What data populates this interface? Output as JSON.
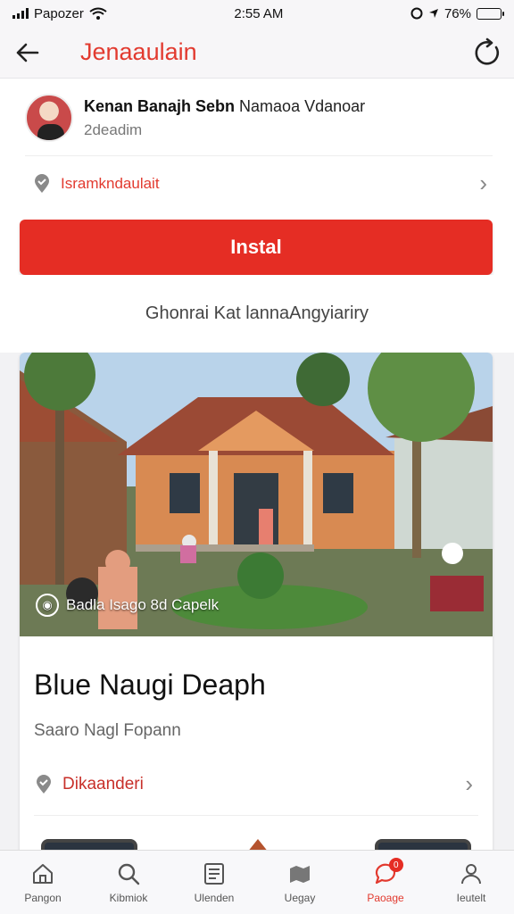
{
  "status_bar": {
    "carrier": "Papozer",
    "time": "2:55 AM",
    "battery": "76%",
    "battery_level": 0.68
  },
  "header": {
    "title": "Jenaaulain",
    "back_icon": "back-arrow-icon",
    "refresh_icon": "refresh-icon"
  },
  "profile": {
    "name": "Kenan Banajh Sebn",
    "name_suffix": "Namaoa Vdanoar",
    "subtitle": "2deadim",
    "location": "Isramkndaulait"
  },
  "install_label": "Instal",
  "subtitle": "Ghonrai Kat lannaAngyiariry",
  "post": {
    "photo_caption": "Badla Isago 8d Capelk",
    "title": "Blue Naugi Deaph",
    "subtitle": "Saaro Nagl Fopann",
    "location": "Dikaanderi"
  },
  "tabs": [
    {
      "label": "Pangon",
      "icon": "home-icon",
      "active": false
    },
    {
      "label": "Kibmiok",
      "icon": "search-icon",
      "active": false
    },
    {
      "label": "Ulenden",
      "icon": "list-icon",
      "active": false
    },
    {
      "label": "Uegay",
      "icon": "map-icon",
      "active": false
    },
    {
      "label": "Paoage",
      "icon": "chat-icon",
      "active": true,
      "badge": "0"
    },
    {
      "label": "Ieutelt",
      "icon": "profile-icon",
      "active": false
    }
  ],
  "colors": {
    "accent": "#e23a2f",
    "button": "#e52d24"
  }
}
